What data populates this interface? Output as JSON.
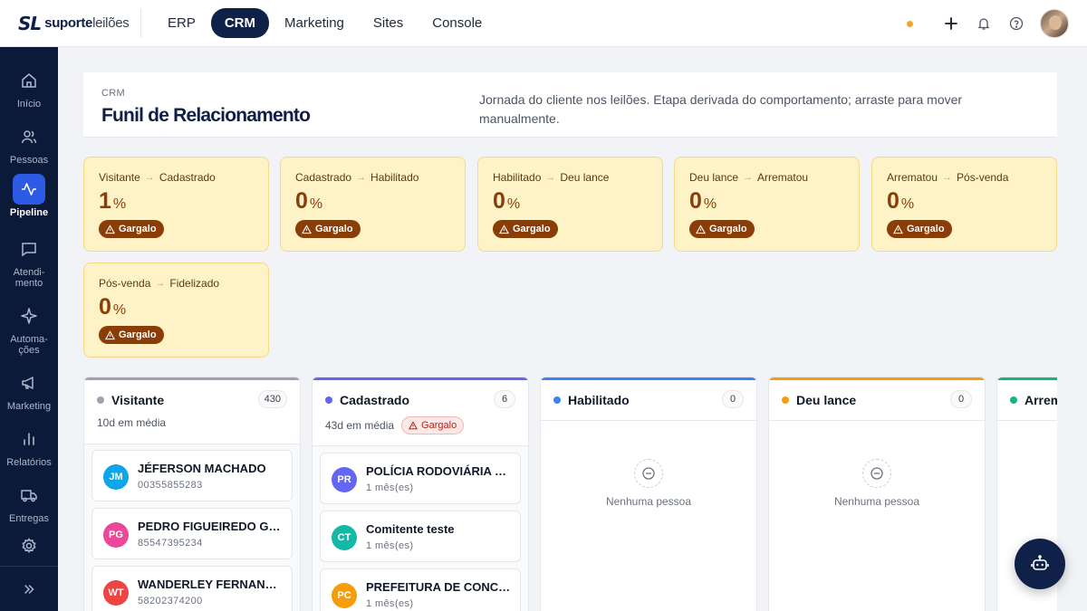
{
  "brand": {
    "mark": "SL",
    "name_bold": "suporte",
    "name_light": "leilões"
  },
  "nav": [
    {
      "label": "ERP",
      "active": false
    },
    {
      "label": "CRM",
      "active": true
    },
    {
      "label": "Marketing",
      "active": false
    },
    {
      "label": "Sites",
      "active": false
    },
    {
      "label": "Console",
      "active": false
    }
  ],
  "sidebar": [
    {
      "label": "Início",
      "icon": "home-icon"
    },
    {
      "label": "Pessoas",
      "icon": "users-icon"
    },
    {
      "label": "Pipeline",
      "icon": "activity-icon",
      "active": true
    },
    {
      "label_1": "Atendi-",
      "label_2": "mento",
      "icon": "chat-icon"
    },
    {
      "label_1": "Automa-",
      "label_2": "ções",
      "icon": "sparkle-icon"
    },
    {
      "label": "Marketing",
      "icon": "megaphone-icon"
    },
    {
      "label": "Relatórios",
      "icon": "bar-chart-icon"
    },
    {
      "label": "Entregas",
      "icon": "truck-icon"
    },
    {
      "label": "",
      "icon": "gear-icon"
    }
  ],
  "header": {
    "crumb": "CRM",
    "title": "Funil de Relacionamento",
    "description": "Jornada do cliente nos leilões. Etapa derivada do comportamento; arraste para mover manualmente."
  },
  "metrics": [
    {
      "from": "Visitante",
      "to": "Cadastrado",
      "value": "1",
      "unit": "%",
      "badge": "Gargalo"
    },
    {
      "from": "Cadastrado",
      "to": "Habilitado",
      "value": "0",
      "unit": "%",
      "badge": "Gargalo"
    },
    {
      "from": "Habilitado",
      "to": "Deu lance",
      "value": "0",
      "unit": "%",
      "badge": "Gargalo"
    },
    {
      "from": "Deu lance",
      "to": "Arrematou",
      "value": "0",
      "unit": "%",
      "badge": "Gargalo"
    },
    {
      "from": "Arrematou",
      "to": "Pós-venda",
      "value": "0",
      "unit": "%",
      "badge": "Gargalo"
    },
    {
      "from": "Pós-venda",
      "to": "Fidelizado",
      "value": "0",
      "unit": "%",
      "badge": "Gargalo"
    }
  ],
  "columns": [
    {
      "title": "Visitante",
      "count": "430",
      "color": "#9ca3af",
      "avg": "10d em média",
      "cards": [
        {
          "initials": "JM",
          "name": "JÉFERSON MACHADO",
          "sub": "00355855283",
          "color": "#0ea5e9"
        },
        {
          "initials": "PG",
          "name": "PEDRO FIGUEIREDO GONÇALVES",
          "sub": "85547395234",
          "color": "#ec4899"
        },
        {
          "initials": "WT",
          "name": "WANDERLEY FERNANDES TAVARES",
          "sub": "58202374200",
          "color": "#ef4444"
        }
      ]
    },
    {
      "title": "Cadastrado",
      "count": "6",
      "color": "#6366f1",
      "avg": "43d em média",
      "badge": "Gargalo",
      "cards": [
        {
          "initials": "PR",
          "name": "POLÍCIA RODOVIÁRIA FEDERAL",
          "sub": "1 mês(es)",
          "color": "#6366f1"
        },
        {
          "initials": "CT",
          "name": "Comitente teste",
          "sub": "1 mês(es)",
          "color": "#14b8a6"
        },
        {
          "initials": "PC",
          "name": "PREFEITURA DE CONCEIÇÃO",
          "sub": "1 mês(es)",
          "color": "#f59e0b"
        }
      ]
    },
    {
      "title": "Habilitado",
      "count": "0",
      "color": "#3b82f6",
      "empty": "Nenhuma pessoa"
    },
    {
      "title": "Deu lance",
      "count": "0",
      "color": "#f59e0b",
      "empty": "Nenhuma pessoa"
    },
    {
      "title": "Arrematou",
      "color": "#10b981"
    }
  ]
}
